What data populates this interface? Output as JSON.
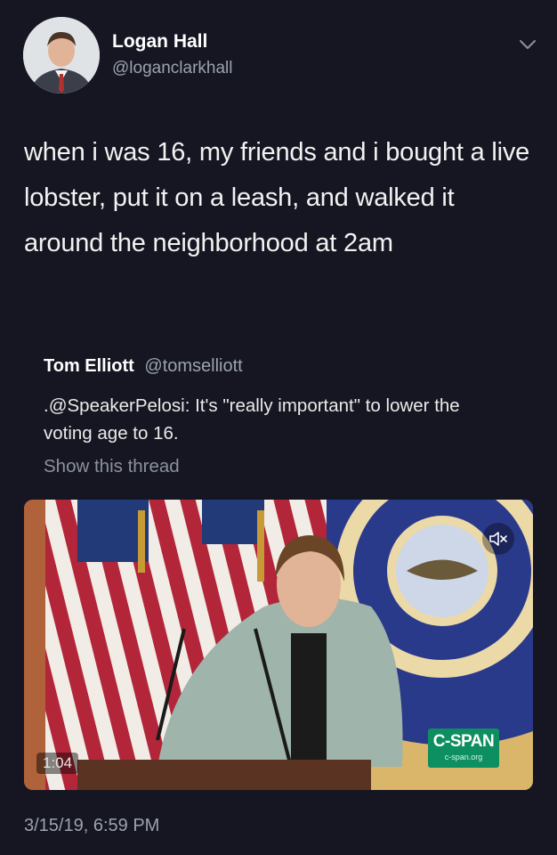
{
  "user": {
    "name": "Logan Hall",
    "handle": "@loganclarkhall"
  },
  "tweet": {
    "text": "when i was 16, my friends and i bought a live lobster, put it on a leash, and walked it around the neighborhood at 2am",
    "timestamp": "3/15/19, 6:59 PM"
  },
  "quoted": {
    "name": "Tom Elliott",
    "handle": "@tomselliott",
    "text": ".@SpeakerPelosi: It's \"really important\" to lower the voting age to 16.",
    "show_thread": "Show this thread"
  },
  "video": {
    "duration": "1:04",
    "network_logo": "C-SPAN",
    "network_url": "c-span.org",
    "icons": [
      "mute-icon"
    ]
  },
  "icons": [
    "chevron-down-icon"
  ],
  "colors": {
    "background": "#161622",
    "secondary_text": "#9aa3ad",
    "cspan_green": "#0e8f62"
  }
}
